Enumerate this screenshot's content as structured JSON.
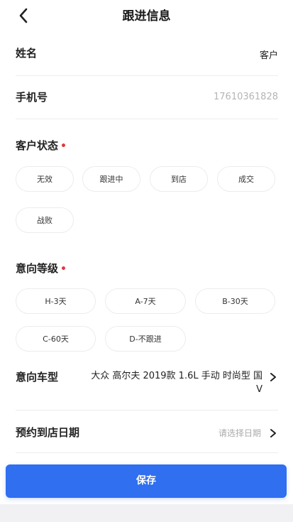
{
  "header": {
    "title": "跟进信息"
  },
  "name_row": {
    "label": "姓名",
    "value": "客户"
  },
  "phone_row": {
    "label": "手机号",
    "value": "17610361828"
  },
  "customer_status": {
    "label": "客户状态",
    "required_mark": "•",
    "options": [
      "无效",
      "跟进中",
      "到店",
      "成交",
      "战败"
    ]
  },
  "intent_level": {
    "label": "意向等级",
    "required_mark": "•",
    "options": [
      "H-3天",
      "A-7天",
      "B-30天",
      "C-60天",
      "D-不跟进"
    ]
  },
  "intent_model": {
    "label": "意向车型",
    "value": "大众 高尔夫 2019款 1.6L 手动 时尚型 国V"
  },
  "appointment_date": {
    "label": "预约到店日期",
    "placeholder": "请选择日期"
  },
  "save_button": {
    "label": "保存"
  },
  "colors": {
    "accent": "#2f6ff0",
    "required": "#e0383e"
  }
}
